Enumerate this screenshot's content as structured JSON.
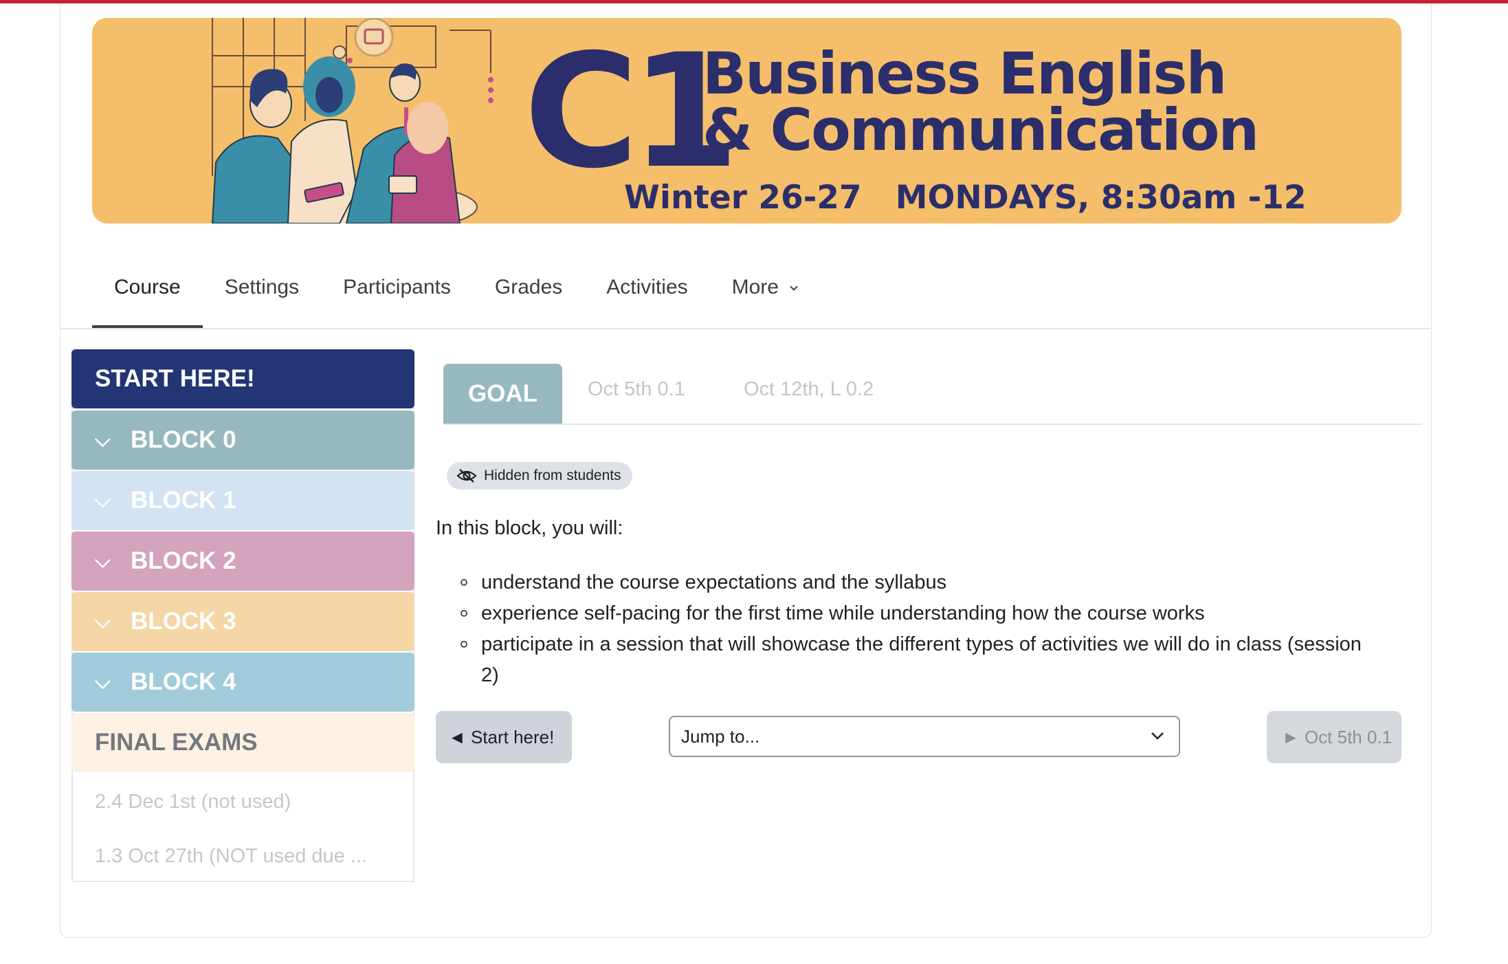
{
  "banner": {
    "c1": "C1",
    "title_line1": "Business English",
    "title_line2": "& Communication",
    "subtitle": "Winter 26-27   MONDAYS, 8:30am -12",
    "bg_color": "#f5be6a",
    "text_color": "#2b2e6b"
  },
  "nav": {
    "tabs": [
      {
        "label": "Course",
        "active": true
      },
      {
        "label": "Settings"
      },
      {
        "label": "Participants"
      },
      {
        "label": "Grades"
      },
      {
        "label": "Activities"
      },
      {
        "label": "More"
      }
    ],
    "more_icon": "chevron-down-icon"
  },
  "sidebar": {
    "start": "START HERE!",
    "blocks": [
      "BLOCK 0",
      "BLOCK 1",
      "BLOCK 2",
      "BLOCK 3",
      "BLOCK 4"
    ],
    "final": "FINAL EXAMS",
    "sub_items": [
      "2.4 Dec 1st (not used)",
      "1.3 Oct 27th (NOT used due ..."
    ],
    "colors": {
      "start": "#233574",
      "block0": "#98b8c0",
      "block1": "#d4e3f4",
      "block2": "#d4a3bc",
      "block3": "#f5d6a7",
      "block4": "#a1cbda",
      "final": "#fcf1e2"
    }
  },
  "content": {
    "tabs": [
      "GOAL",
      "Oct 5th 0.1",
      "Oct 12th, L 0.2"
    ],
    "hidden_badge": "Hidden from students",
    "hidden_icon": "eye-slash-icon",
    "intro": "In this block, you will:",
    "goals": [
      "understand the course expectations and the syllabus",
      "experience self-pacing for the first time while understanding how the course works",
      "participate in a session that will showcase the different types of activities we will do in class (session 2)"
    ]
  },
  "footer_nav": {
    "prev": "◄ Start here!",
    "jump_placeholder": "Jump to...",
    "next": "► Oct 5th 0.1"
  }
}
